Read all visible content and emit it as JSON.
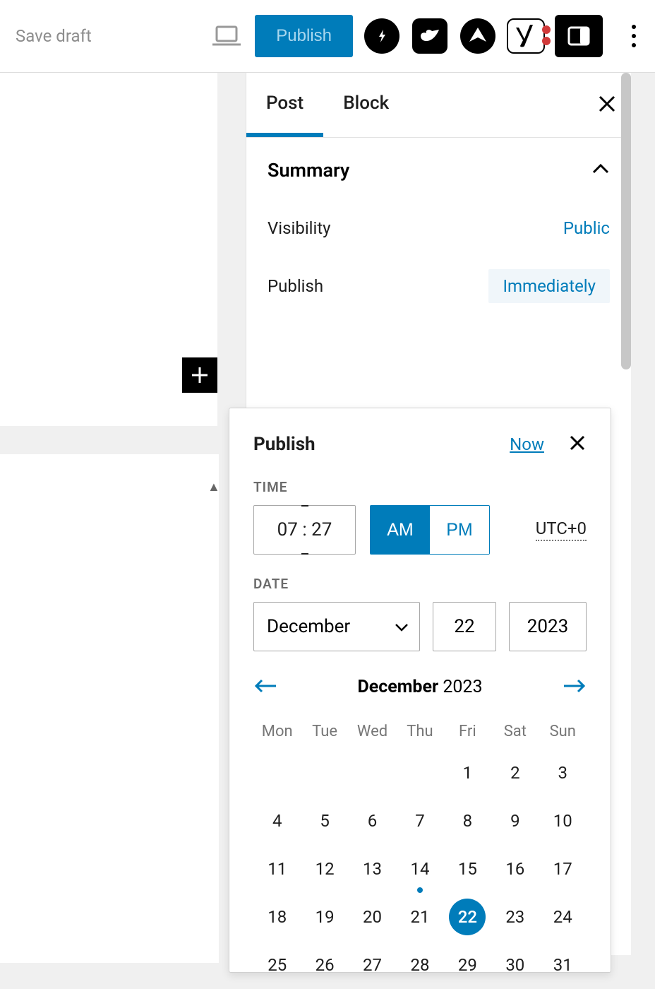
{
  "toolbar": {
    "save_draft": "Save draft",
    "publish_label": "Publish"
  },
  "sidebar": {
    "tabs": {
      "post": "Post",
      "block": "Block",
      "active": "post"
    },
    "section_title": "Summary",
    "rows": {
      "visibility": {
        "label": "Visibility",
        "value": "Public"
      },
      "publish": {
        "label": "Publish",
        "value": "Immediately"
      }
    }
  },
  "popover": {
    "title": "Publish",
    "now_label": "Now",
    "time_label": "TIME",
    "date_label": "DATE",
    "hour": "07",
    "minute": "27",
    "ampm": {
      "am": "AM",
      "pm": "PM",
      "selected": "AM"
    },
    "timezone": "UTC+0",
    "month": "December",
    "day": "22",
    "year": "2023",
    "calendar": {
      "nav_month": "December",
      "nav_year": "2023",
      "weekdays": [
        "Mon",
        "Tue",
        "Wed",
        "Thu",
        "Fri",
        "Sat",
        "Sun"
      ],
      "first_weekday_index": 4,
      "days_in_month": 31,
      "today": 14,
      "selected": 22
    }
  },
  "colors": {
    "accent": "#007cba"
  }
}
